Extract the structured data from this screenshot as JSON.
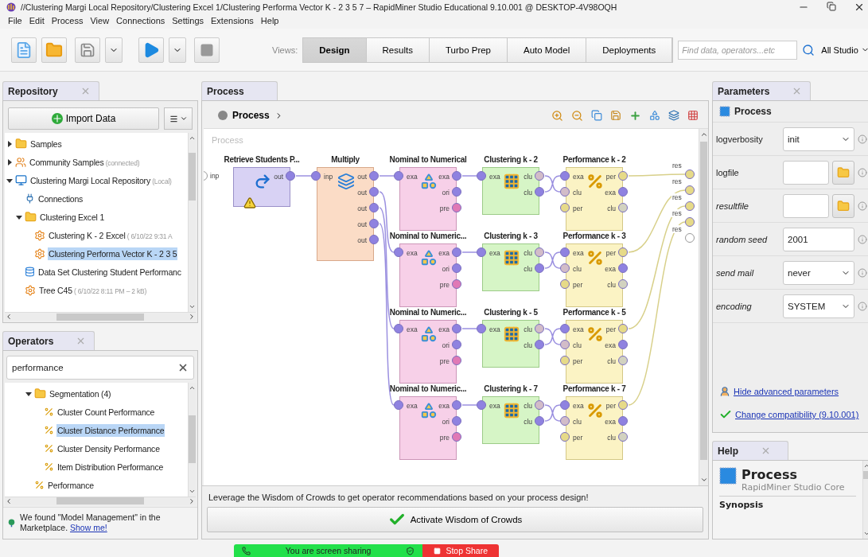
{
  "window": {
    "title": "//Clustering Margi  Local Repository/Clustering Excel 1/Clustering Performa Vector K - 2 3 5 7  – RapidMiner Studio Educational 9.10.001 @ DESKTOP-4V98OQH"
  },
  "menu": [
    "File",
    "Edit",
    "Process",
    "View",
    "Connections",
    "Settings",
    "Extensions",
    "Help"
  ],
  "toolbar": {
    "views_label": "Views:",
    "views": [
      {
        "label": "Design",
        "selected": true
      },
      {
        "label": "Results",
        "selected": false
      },
      {
        "label": "Turbo Prep",
        "selected": false
      },
      {
        "label": "Auto Model",
        "selected": false
      },
      {
        "label": "Deployments",
        "selected": false
      }
    ],
    "search": {
      "placeholder": "Find data, operators...etc"
    },
    "scope": "All Studio"
  },
  "repository": {
    "tab": "Repository",
    "import_button": "Import Data",
    "tree": [
      {
        "label": "Samples",
        "kind": "folder",
        "expanded": false,
        "selected": false
      },
      {
        "label": "Community Samples",
        "note": "(connected)",
        "kind": "community",
        "expanded": false,
        "selected": false
      },
      {
        "label": "Clustering Margi  Local Repository",
        "note": "(Local)",
        "kind": "repo",
        "expanded": true,
        "selected": false,
        "children": [
          {
            "label": "Connections",
            "kind": "connections",
            "selected": false
          },
          {
            "label": "Clustering Excel 1",
            "kind": "folder",
            "expanded": true,
            "selected": false,
            "children": [
              {
                "label": "Clustering K - 2 Excel",
                "note": "( 6/10/22 9:31 A",
                "kind": "process",
                "selected": false
              },
              {
                "label": "Clustering Performa Vector K - 2 3 5",
                "kind": "process",
                "selected": true
              }
            ]
          },
          {
            "label": "Data Set Clustering Student Performanc",
            "kind": "data",
            "selected": false
          },
          {
            "label": "Tree C45",
            "note": "( 6/10/22 8:11 PM – 2 kB)",
            "kind": "process",
            "selected": false
          }
        ]
      }
    ]
  },
  "operators": {
    "tab": "Operators",
    "search": {
      "value": "performance"
    },
    "tree": [
      {
        "label": "Segmentation (4)",
        "kind": "folder",
        "expanded": true,
        "selected": false,
        "children": [
          {
            "label": "Cluster Count Performance",
            "kind": "operator",
            "selected": false
          },
          {
            "label": "Cluster Distance Performance",
            "kind": "operator",
            "selected": true
          },
          {
            "label": "Cluster Density Performance",
            "kind": "operator",
            "selected": false
          },
          {
            "label": "Item Distribution Performance",
            "kind": "operator",
            "selected": false
          }
        ]
      },
      {
        "label": "Performance",
        "kind": "operator",
        "selected": false
      }
    ],
    "notice": {
      "text": "We found \"Model Management\" in the Marketplace.",
      "link": "Show me!"
    }
  },
  "process": {
    "tab": "Process",
    "breadcrumb": "Process",
    "canvas_label": "Process",
    "input_port": "inp",
    "sources": [
      {
        "title": "Retrieve Students P...",
        "kind": "retrieve",
        "warning": true,
        "out_ports": [
          {
            "label": "out",
            "color": "#8f82e0"
          }
        ]
      },
      {
        "title": "Multiply",
        "kind": "multiply",
        "warning": false,
        "in_ports": [
          {
            "label": "inp",
            "color": "#8f82e0"
          }
        ],
        "out_ports": [
          {
            "label": "out",
            "color": "#8f82e0"
          },
          {
            "label": "out",
            "color": "#8f82e0"
          },
          {
            "label": "out",
            "color": "#8f82e0"
          },
          {
            "label": "out",
            "color": "#8f82e0"
          },
          {
            "label": "out",
            "color": "#8f82e0"
          }
        ]
      }
    ],
    "branches": [
      [
        {
          "title": "Nominal to Numerical",
          "kind": "nominal",
          "warning": false,
          "in_ports": [
            {
              "label": "exa",
              "color": "#8f82e0"
            }
          ],
          "out_ports": [
            {
              "label": "exa",
              "color": "#8f82e0"
            },
            {
              "label": "ori",
              "color": "#8f82e0"
            },
            {
              "label": "pre",
              "color": "#e079b5"
            }
          ]
        },
        {
          "title": "Clustering k - 2",
          "kind": "clustering",
          "warning": false,
          "in_ports": [
            {
              "label": "exa",
              "color": "#8f82e0"
            }
          ],
          "out_ports": [
            {
              "label": "clu",
              "color": "#d2bcc8"
            },
            {
              "label": "clu",
              "color": "#8f82e0"
            }
          ]
        },
        {
          "title": "Performance k - 2",
          "kind": "performance",
          "warning": false,
          "in_ports": [
            {
              "label": "exa",
              "color": "#8f82e0"
            },
            {
              "label": "clu",
              "color": "#d2bcc8"
            },
            {
              "label": "per",
              "color": "#e6da88"
            }
          ],
          "out_ports": [
            {
              "label": "per",
              "color": "#e6da88"
            },
            {
              "label": "exa",
              "color": "#8f82e0"
            },
            {
              "label": "clu",
              "color": "#d2d2c0"
            }
          ]
        }
      ],
      [
        {
          "title": "Nominal to Numeric...",
          "kind": "nominal",
          "warning": false,
          "in_ports": [
            {
              "label": "exa",
              "color": "#8f82e0"
            }
          ],
          "out_ports": [
            {
              "label": "exa",
              "color": "#8f82e0"
            },
            {
              "label": "ori",
              "color": "#8f82e0"
            },
            {
              "label": "pre",
              "color": "#e079b5"
            }
          ]
        },
        {
          "title": "Clustering k - 3",
          "kind": "clustering",
          "warning": false,
          "in_ports": [
            {
              "label": "exa",
              "color": "#8f82e0"
            }
          ],
          "out_ports": [
            {
              "label": "clu",
              "color": "#d2bcc8"
            },
            {
              "label": "clu",
              "color": "#8f82e0"
            }
          ]
        },
        {
          "title": "Performance k - 3",
          "kind": "performance",
          "warning": false,
          "in_ports": [
            {
              "label": "exa",
              "color": "#8f82e0"
            },
            {
              "label": "clu",
              "color": "#d2bcc8"
            },
            {
              "label": "per",
              "color": "#e6da88"
            }
          ],
          "out_ports": [
            {
              "label": "per",
              "color": "#e6da88"
            },
            {
              "label": "exa",
              "color": "#8f82e0"
            },
            {
              "label": "clu",
              "color": "#d2d2c0"
            }
          ]
        }
      ],
      [
        {
          "title": "Nominal to Numeric...",
          "kind": "nominal",
          "warning": false,
          "in_ports": [
            {
              "label": "exa",
              "color": "#8f82e0"
            }
          ],
          "out_ports": [
            {
              "label": "exa",
              "color": "#8f82e0"
            },
            {
              "label": "ori",
              "color": "#8f82e0"
            },
            {
              "label": "pre",
              "color": "#e079b5"
            }
          ]
        },
        {
          "title": "Clustering k - 5",
          "kind": "clustering",
          "warning": false,
          "in_ports": [
            {
              "label": "exa",
              "color": "#8f82e0"
            }
          ],
          "out_ports": [
            {
              "label": "clu",
              "color": "#d2bcc8"
            },
            {
              "label": "clu",
              "color": "#8f82e0"
            }
          ]
        },
        {
          "title": "Performance k - 5",
          "kind": "performance",
          "warning": false,
          "in_ports": [
            {
              "label": "exa",
              "color": "#8f82e0"
            },
            {
              "label": "clu",
              "color": "#d2bcc8"
            },
            {
              "label": "per",
              "color": "#e6da88"
            }
          ],
          "out_ports": [
            {
              "label": "per",
              "color": "#e6da88"
            },
            {
              "label": "exa",
              "color": "#8f82e0"
            },
            {
              "label": "clu",
              "color": "#d2d2c0"
            }
          ]
        }
      ],
      [
        {
          "title": "Nominal to Numeric...",
          "kind": "nominal",
          "warning": false,
          "in_ports": [
            {
              "label": "exa",
              "color": "#8f82e0"
            }
          ],
          "out_ports": [
            {
              "label": "exa",
              "color": "#8f82e0"
            },
            {
              "label": "ori",
              "color": "#8f82e0"
            },
            {
              "label": "pre",
              "color": "#e079b5"
            }
          ]
        },
        {
          "title": "Clustering k - 7",
          "kind": "clustering",
          "warning": false,
          "in_ports": [
            {
              "label": "exa",
              "color": "#8f82e0"
            }
          ],
          "out_ports": [
            {
              "label": "clu",
              "color": "#d2bcc8"
            },
            {
              "label": "clu",
              "color": "#8f82e0"
            }
          ]
        },
        {
          "title": "Performance k - 7",
          "kind": "performance",
          "warning": false,
          "in_ports": [
            {
              "label": "exa",
              "color": "#8f82e0"
            },
            {
              "label": "clu",
              "color": "#d2bcc8"
            },
            {
              "label": "per",
              "color": "#e6da88"
            }
          ],
          "out_ports": [
            {
              "label": "per",
              "color": "#e6da88"
            },
            {
              "label": "exa",
              "color": "#8f82e0"
            },
            {
              "label": "clu",
              "color": "#d2d2c0"
            }
          ]
        }
      ]
    ],
    "result_ports": [
      {
        "label": "res",
        "connected": true
      },
      {
        "label": "res",
        "connected": true
      },
      {
        "label": "res",
        "connected": true
      },
      {
        "label": "res",
        "connected": true
      },
      {
        "label": "res",
        "connected": false
      }
    ],
    "hint": "Leverage the Wisdom of Crowds to get operator recommendations based on your process design!",
    "wisdom_button": "Activate Wisdom of Crowds"
  },
  "parameters": {
    "tab": "Parameters",
    "operator": "Process",
    "rows": [
      {
        "label": "logverbosity",
        "expert": false,
        "kind": "select",
        "value": "init"
      },
      {
        "label": "logfile",
        "expert": false,
        "kind": "file"
      },
      {
        "label": "resultfile",
        "expert": true,
        "kind": "file"
      },
      {
        "label": "random seed",
        "expert": true,
        "kind": "text",
        "value": "2001"
      },
      {
        "label": "send mail",
        "expert": true,
        "kind": "select",
        "value": "never"
      },
      {
        "label": "encoding",
        "expert": true,
        "kind": "select",
        "value": "SYSTEM"
      }
    ],
    "links": [
      {
        "kind": "advanced",
        "label": "Hide advanced parameters"
      },
      {
        "kind": "compatibility",
        "label": "Change compatibility (9.10.001)"
      }
    ]
  },
  "help": {
    "tab": "Help",
    "title": "Process",
    "subtitle": "RapidMiner Studio Core",
    "section": "Synopsis"
  },
  "screen_share": {
    "status": "You are screen sharing",
    "stop_button": "Stop Share"
  }
}
